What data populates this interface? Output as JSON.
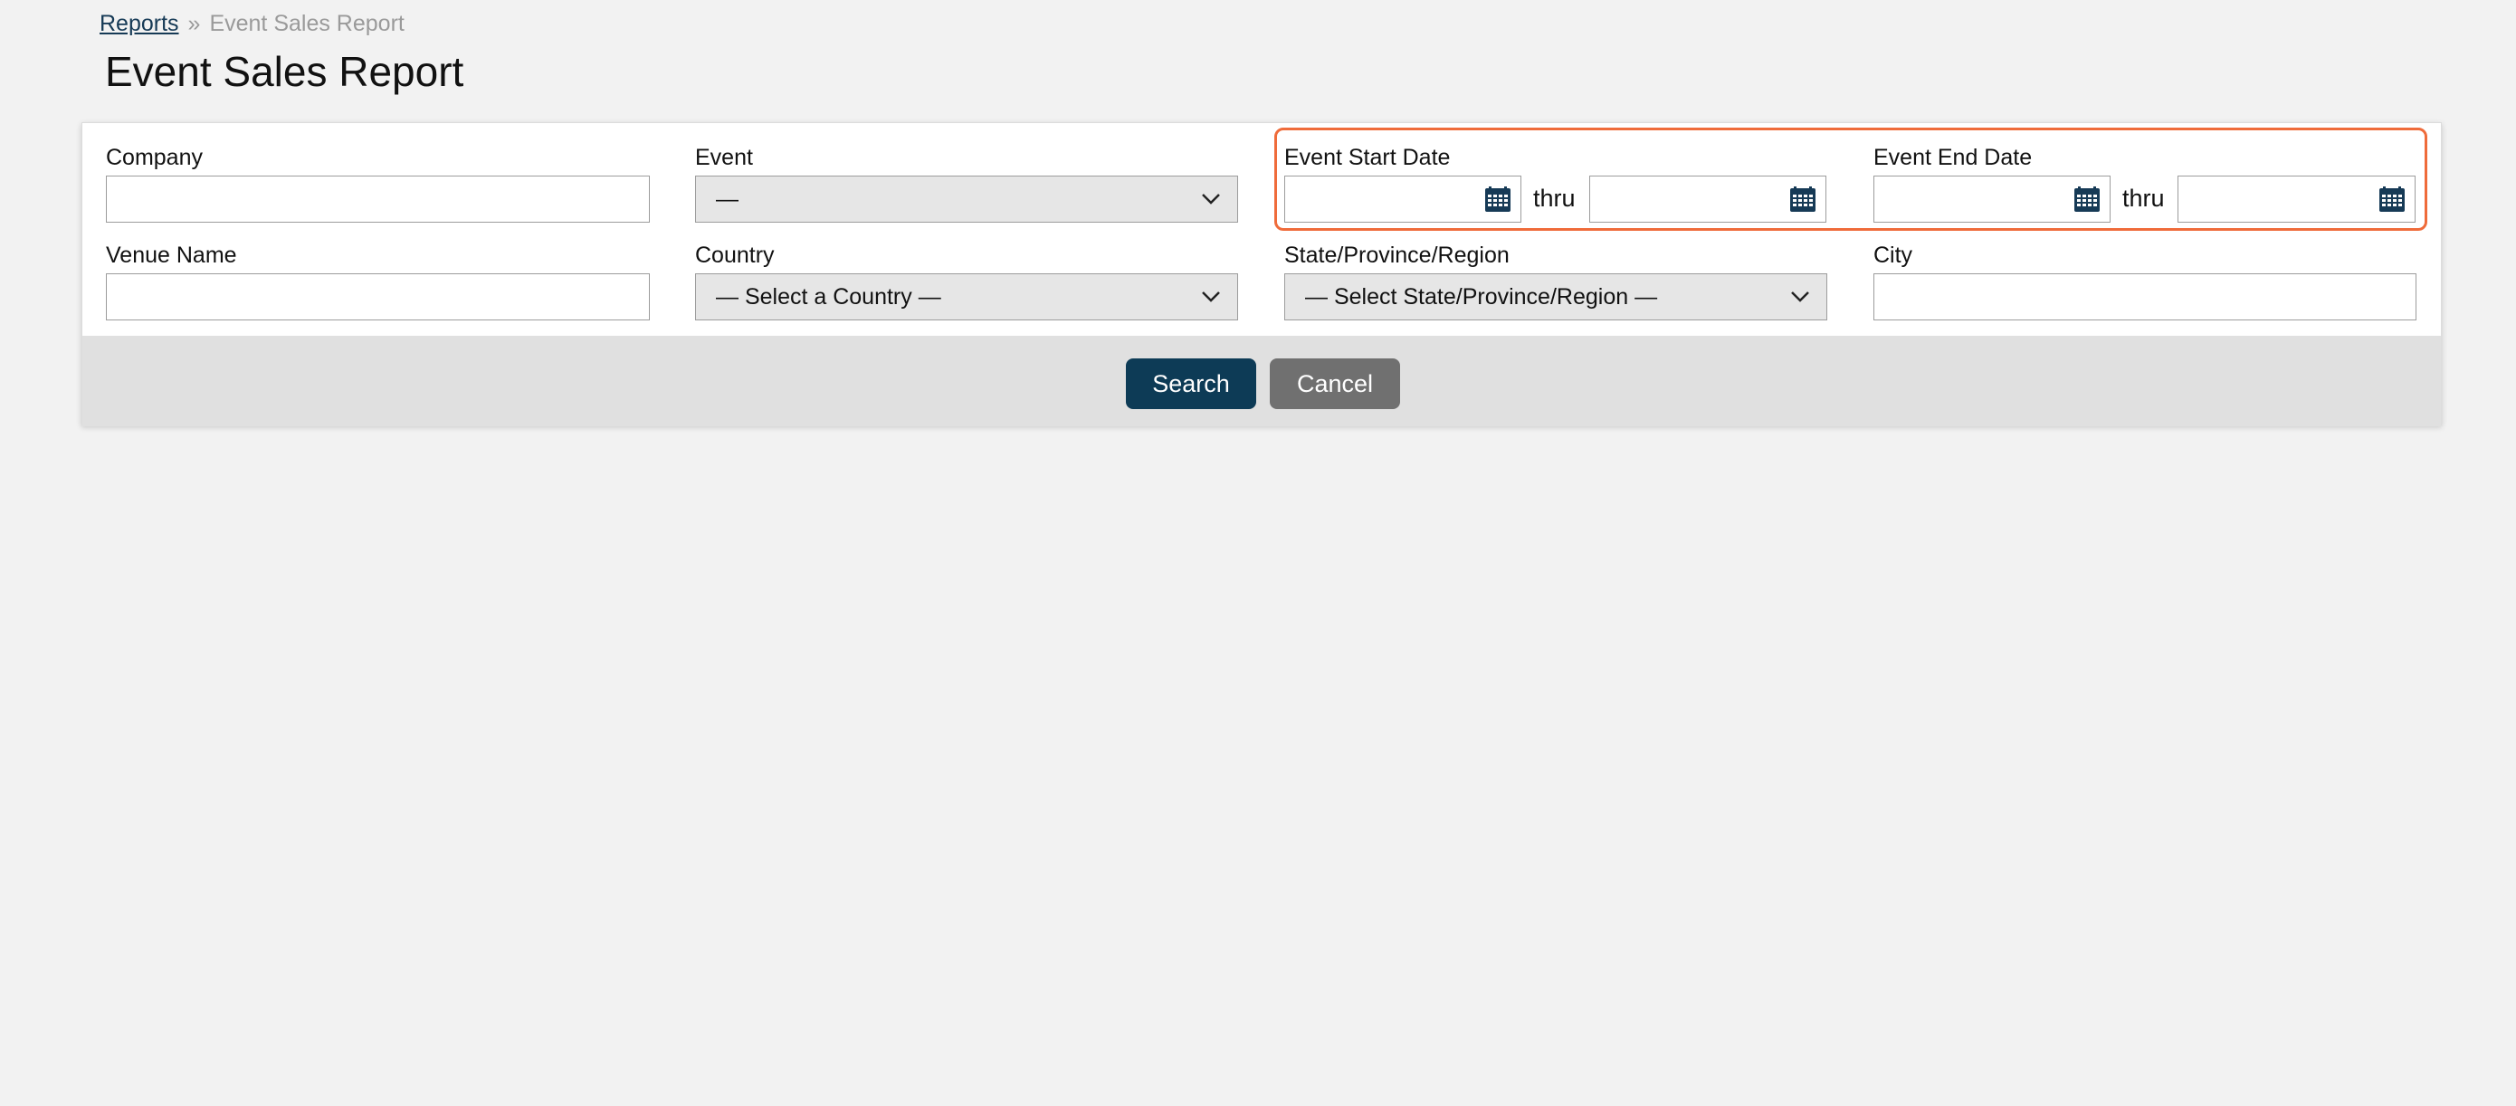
{
  "breadcrumb": {
    "parent": "Reports",
    "separator": "»",
    "current": "Event Sales Report"
  },
  "page": {
    "title": "Event Sales Report"
  },
  "form": {
    "company": {
      "label": "Company",
      "value": ""
    },
    "event": {
      "label": "Event",
      "selected": "—"
    },
    "event_start_date": {
      "label": "Event Start Date",
      "from": "",
      "thru_label": "thru",
      "to": ""
    },
    "event_end_date": {
      "label": "Event End Date",
      "from": "",
      "thru_label": "thru",
      "to": ""
    },
    "venue_name": {
      "label": "Venue Name",
      "value": ""
    },
    "country": {
      "label": "Country",
      "selected": "— Select a Country —"
    },
    "state": {
      "label": "State/Province/Region",
      "selected": "— Select State/Province/Region —"
    },
    "city": {
      "label": "City",
      "value": ""
    }
  },
  "buttons": {
    "search": "Search",
    "cancel": "Cancel"
  },
  "icons": {
    "date_picker": "calendar-icon",
    "dropdown": "chevron-down-icon"
  },
  "colors": {
    "primary_button": "#0d3b56",
    "secondary_button": "#707070",
    "highlight": "#ef6b3a",
    "link": "#163a56"
  }
}
